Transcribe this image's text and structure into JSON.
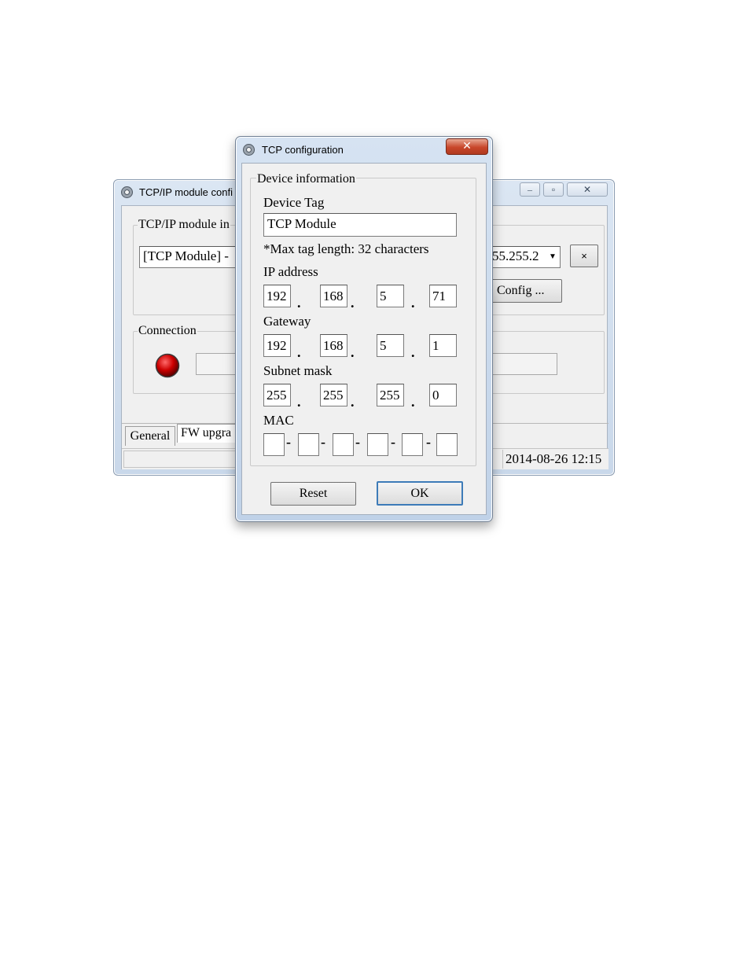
{
  "main_window": {
    "title": "TCP/IP module confi",
    "group_module_label": "TCP/IP module in",
    "module_select_value": "[TCP Module] -",
    "netmask_select_value": "55.255.2",
    "remove_button_label": "×",
    "config_button_label": "Config ...",
    "group_connection_label": "Connection",
    "connection_status_color": "#cc0000",
    "tabs": [
      {
        "label": "General"
      },
      {
        "label": "FW upgra"
      }
    ],
    "status_timestamp": "2014-08-26 12:15",
    "window_buttons": {
      "minimize": "–",
      "maximize": "▫",
      "close": "✕"
    }
  },
  "dialog": {
    "title": "TCP configuration",
    "close_label": "✕",
    "group_label": "Device information",
    "device_tag_label": "Device Tag",
    "device_tag_value": "TCP Module",
    "tag_note": "*Max tag length: 32 characters",
    "ip_label": "IP address",
    "ip": [
      "192",
      "168",
      "5",
      "71"
    ],
    "gateway_label": "Gateway",
    "gateway": [
      "192",
      "168",
      "5",
      "1"
    ],
    "subnet_label": "Subnet mask",
    "subnet": [
      "255",
      "255",
      "255",
      "0"
    ],
    "mac_label": "MAC",
    "mac": [
      "",
      "",
      "",
      "",
      "",
      ""
    ],
    "reset_label": "Reset",
    "ok_label": "OK"
  }
}
